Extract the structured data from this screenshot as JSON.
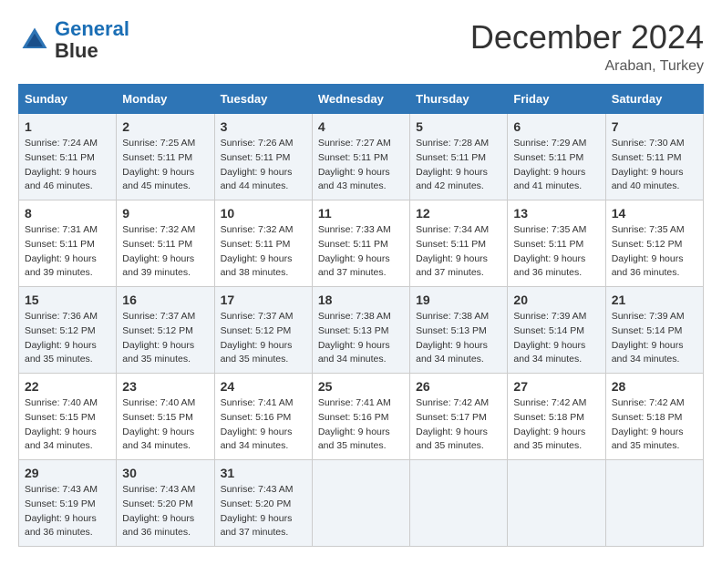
{
  "header": {
    "logo_text1": "General",
    "logo_text2": "Blue",
    "month_title": "December 2024",
    "location": "Araban, Turkey"
  },
  "days_of_week": [
    "Sunday",
    "Monday",
    "Tuesday",
    "Wednesday",
    "Thursday",
    "Friday",
    "Saturday"
  ],
  "weeks": [
    [
      {
        "day": "1",
        "sunrise": "7:24 AM",
        "sunset": "5:11 PM",
        "daylight_hours": "9 hours",
        "daylight_mins": "46 minutes."
      },
      {
        "day": "2",
        "sunrise": "7:25 AM",
        "sunset": "5:11 PM",
        "daylight_hours": "9 hours",
        "daylight_mins": "45 minutes."
      },
      {
        "day": "3",
        "sunrise": "7:26 AM",
        "sunset": "5:11 PM",
        "daylight_hours": "9 hours",
        "daylight_mins": "44 minutes."
      },
      {
        "day": "4",
        "sunrise": "7:27 AM",
        "sunset": "5:11 PM",
        "daylight_hours": "9 hours",
        "daylight_mins": "43 minutes."
      },
      {
        "day": "5",
        "sunrise": "7:28 AM",
        "sunset": "5:11 PM",
        "daylight_hours": "9 hours",
        "daylight_mins": "42 minutes."
      },
      {
        "day": "6",
        "sunrise": "7:29 AM",
        "sunset": "5:11 PM",
        "daylight_hours": "9 hours",
        "daylight_mins": "41 minutes."
      },
      {
        "day": "7",
        "sunrise": "7:30 AM",
        "sunset": "5:11 PM",
        "daylight_hours": "9 hours",
        "daylight_mins": "40 minutes."
      }
    ],
    [
      {
        "day": "8",
        "sunrise": "7:31 AM",
        "sunset": "5:11 PM",
        "daylight_hours": "9 hours",
        "daylight_mins": "39 minutes."
      },
      {
        "day": "9",
        "sunrise": "7:32 AM",
        "sunset": "5:11 PM",
        "daylight_hours": "9 hours",
        "daylight_mins": "39 minutes."
      },
      {
        "day": "10",
        "sunrise": "7:32 AM",
        "sunset": "5:11 PM",
        "daylight_hours": "9 hours",
        "daylight_mins": "38 minutes."
      },
      {
        "day": "11",
        "sunrise": "7:33 AM",
        "sunset": "5:11 PM",
        "daylight_hours": "9 hours",
        "daylight_mins": "37 minutes."
      },
      {
        "day": "12",
        "sunrise": "7:34 AM",
        "sunset": "5:11 PM",
        "daylight_hours": "9 hours",
        "daylight_mins": "37 minutes."
      },
      {
        "day": "13",
        "sunrise": "7:35 AM",
        "sunset": "5:11 PM",
        "daylight_hours": "9 hours",
        "daylight_mins": "36 minutes."
      },
      {
        "day": "14",
        "sunrise": "7:35 AM",
        "sunset": "5:12 PM",
        "daylight_hours": "9 hours",
        "daylight_mins": "36 minutes."
      }
    ],
    [
      {
        "day": "15",
        "sunrise": "7:36 AM",
        "sunset": "5:12 PM",
        "daylight_hours": "9 hours",
        "daylight_mins": "35 minutes."
      },
      {
        "day": "16",
        "sunrise": "7:37 AM",
        "sunset": "5:12 PM",
        "daylight_hours": "9 hours",
        "daylight_mins": "35 minutes."
      },
      {
        "day": "17",
        "sunrise": "7:37 AM",
        "sunset": "5:12 PM",
        "daylight_hours": "9 hours",
        "daylight_mins": "35 minutes."
      },
      {
        "day": "18",
        "sunrise": "7:38 AM",
        "sunset": "5:13 PM",
        "daylight_hours": "9 hours",
        "daylight_mins": "34 minutes."
      },
      {
        "day": "19",
        "sunrise": "7:38 AM",
        "sunset": "5:13 PM",
        "daylight_hours": "9 hours",
        "daylight_mins": "34 minutes."
      },
      {
        "day": "20",
        "sunrise": "7:39 AM",
        "sunset": "5:14 PM",
        "daylight_hours": "9 hours",
        "daylight_mins": "34 minutes."
      },
      {
        "day": "21",
        "sunrise": "7:39 AM",
        "sunset": "5:14 PM",
        "daylight_hours": "9 hours",
        "daylight_mins": "34 minutes."
      }
    ],
    [
      {
        "day": "22",
        "sunrise": "7:40 AM",
        "sunset": "5:15 PM",
        "daylight_hours": "9 hours",
        "daylight_mins": "34 minutes."
      },
      {
        "day": "23",
        "sunrise": "7:40 AM",
        "sunset": "5:15 PM",
        "daylight_hours": "9 hours",
        "daylight_mins": "34 minutes."
      },
      {
        "day": "24",
        "sunrise": "7:41 AM",
        "sunset": "5:16 PM",
        "daylight_hours": "9 hours",
        "daylight_mins": "34 minutes."
      },
      {
        "day": "25",
        "sunrise": "7:41 AM",
        "sunset": "5:16 PM",
        "daylight_hours": "9 hours",
        "daylight_mins": "35 minutes."
      },
      {
        "day": "26",
        "sunrise": "7:42 AM",
        "sunset": "5:17 PM",
        "daylight_hours": "9 hours",
        "daylight_mins": "35 minutes."
      },
      {
        "day": "27",
        "sunrise": "7:42 AM",
        "sunset": "5:18 PM",
        "daylight_hours": "9 hours",
        "daylight_mins": "35 minutes."
      },
      {
        "day": "28",
        "sunrise": "7:42 AM",
        "sunset": "5:18 PM",
        "daylight_hours": "9 hours",
        "daylight_mins": "35 minutes."
      }
    ],
    [
      {
        "day": "29",
        "sunrise": "7:43 AM",
        "sunset": "5:19 PM",
        "daylight_hours": "9 hours",
        "daylight_mins": "36 minutes."
      },
      {
        "day": "30",
        "sunrise": "7:43 AM",
        "sunset": "5:20 PM",
        "daylight_hours": "9 hours",
        "daylight_mins": "36 minutes."
      },
      {
        "day": "31",
        "sunrise": "7:43 AM",
        "sunset": "5:20 PM",
        "daylight_hours": "9 hours",
        "daylight_mins": "37 minutes."
      },
      null,
      null,
      null,
      null
    ]
  ],
  "labels": {
    "sunrise": "Sunrise:",
    "sunset": "Sunset:",
    "daylight": "Daylight:"
  }
}
